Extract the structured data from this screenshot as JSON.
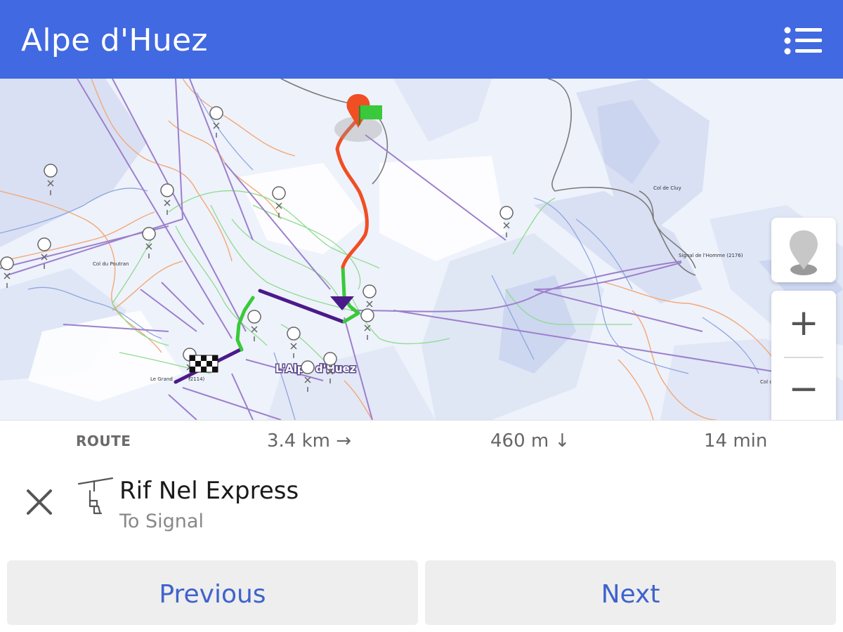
{
  "header": {
    "title": "Alpe d'Huez",
    "menu_icon": "list-icon"
  },
  "map": {
    "labels": {
      "town": "L'Alpe d'Huez",
      "col_chuy": "Col de Cluy",
      "signal_homme": "Signal de l'Homme (2176)",
      "col_poutran": "Col du Poutran",
      "le_grand": "Le Grand",
      "alt_2114": "(2114)",
      "col_right": "Col d"
    },
    "colors": {
      "route_red": "#f04e23",
      "route_green": "#3ac93a",
      "lift_purple": "#4b1a8a",
      "header_blue": "#4169e1"
    },
    "controls": {
      "locate_icon": "location-pin-icon",
      "zoom_in": "+",
      "zoom_out": "−"
    }
  },
  "stats": {
    "label": "ROUTE",
    "distance": "3.4 km →",
    "descent": "460 m ↓",
    "time": "14 min"
  },
  "step": {
    "icon": "chairlift-icon",
    "name": "Rif Nel Express",
    "direction": "To Signal",
    "close_icon": "close-icon"
  },
  "buttons": {
    "previous": "Previous",
    "next": "Next"
  }
}
